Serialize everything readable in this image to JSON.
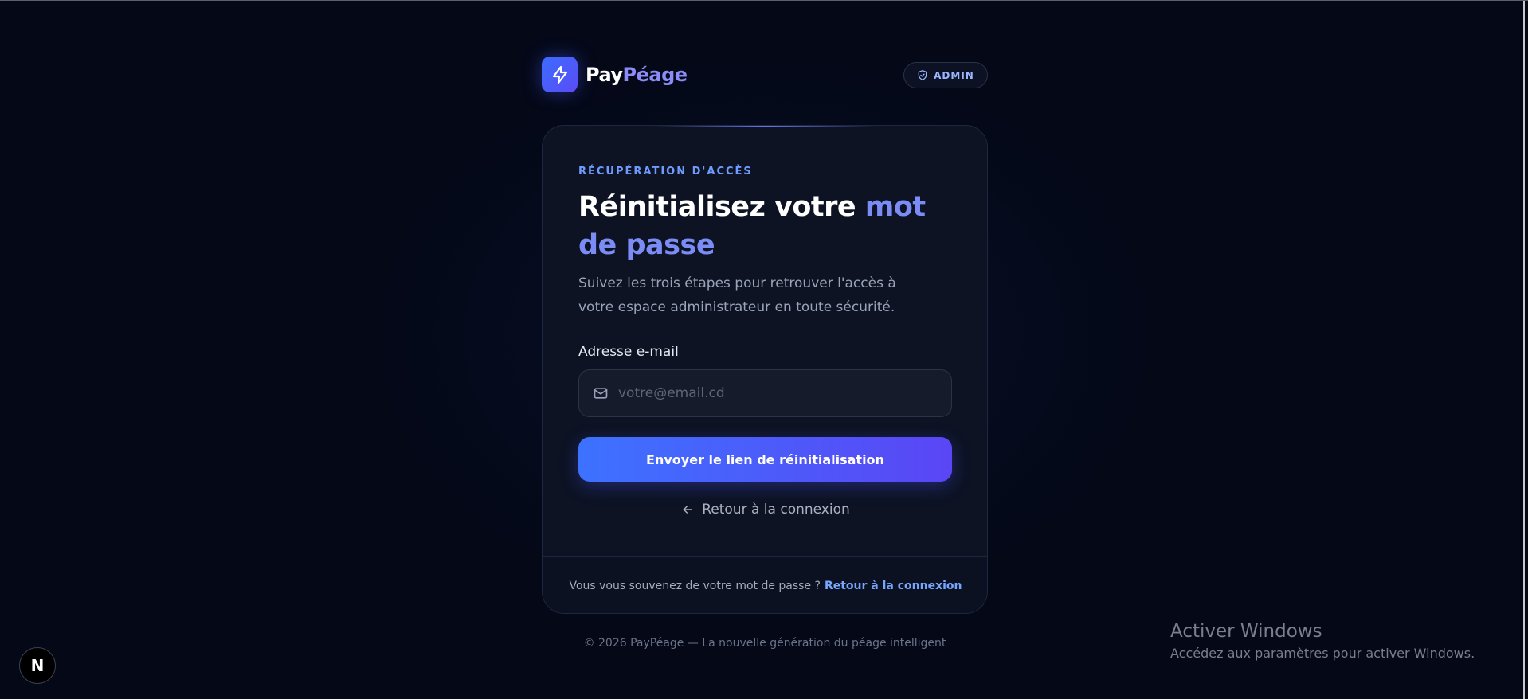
{
  "brand": {
    "name_part1": "Pay",
    "name_part2": "Péage",
    "logo_icon": "lightning-bolt-icon"
  },
  "header": {
    "admin_badge": "ADMIN",
    "admin_icon": "shield-check-icon"
  },
  "card": {
    "eyebrow": "RÉCUPÉRATION D'ACCÈS",
    "title_part1": "Réinitialisez votre ",
    "title_part2": "mot de passe",
    "subtitle": "Suivez les trois étapes pour retrouver l'accès à votre espace administrateur en toute sécurité.",
    "email_label": "Adresse e-mail",
    "email_placeholder": "votre@email.cd",
    "email_value": "",
    "submit_label": "Envoyer le lien de réinitialisation",
    "back_label": "Retour à la connexion",
    "footer_text": "Vous vous souvenez de votre mot de passe ?",
    "footer_link": "Retour à la connexion"
  },
  "footer": {
    "copyright": "© 2026 PayPéage — La nouvelle génération du péage intelligent"
  },
  "dev_badge": "N",
  "windows_watermark": {
    "title": "Activer Windows",
    "subtitle": "Accédez aux paramètres pour activer Windows."
  },
  "colors": {
    "accent": "#7b8cf6",
    "button_start": "#3d72ff",
    "button_end": "#5a46f5",
    "link": "#77a6ff",
    "background": "#040817"
  }
}
